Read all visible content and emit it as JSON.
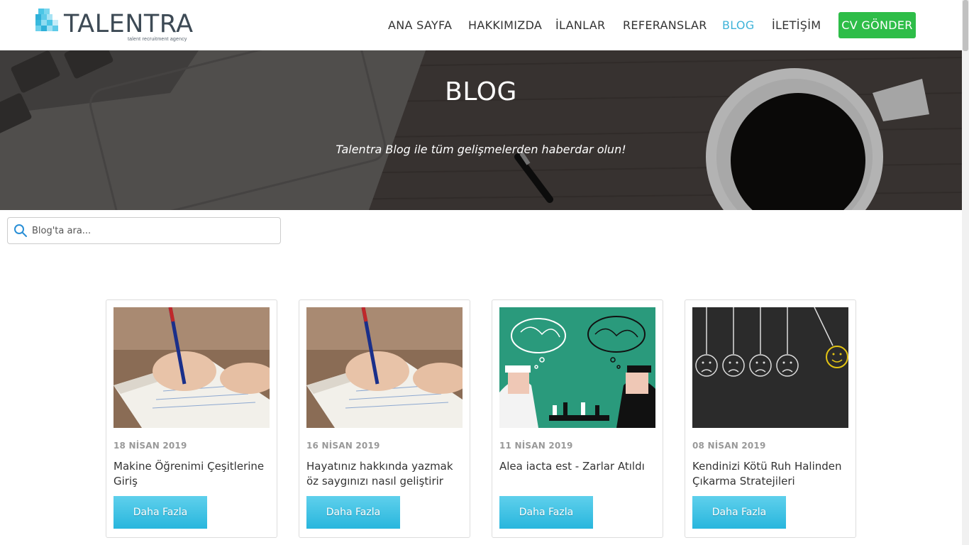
{
  "header": {
    "logo_text": "TALENTRA",
    "logo_tagline": "talent recruitment agency",
    "nav": [
      {
        "label": "ANA SAYFA"
      },
      {
        "label": "HAKKIMIZDA"
      },
      {
        "label": "İLANLAR"
      },
      {
        "label": "REFERANSLAR"
      },
      {
        "label": "BLOG",
        "active": true
      },
      {
        "label": "İLETİŞİM"
      }
    ],
    "cv_button": "CV GÖNDER"
  },
  "hero": {
    "title": "BLOG",
    "subtitle": "Talentra Blog ile tüm gelişmelerden haberdar olun!"
  },
  "search": {
    "placeholder": "Blog'ta ara..."
  },
  "posts": [
    {
      "date": "18 NİSAN 2019",
      "title": "Makine Öğrenimi Çeşitlerine Giriş",
      "button": "Daha Fazla",
      "image": "writing-notebook"
    },
    {
      "date": "16 NİSAN 2019",
      "title": "Hayatınız hakkında yazmak öz saygınızı nasıl geliştirir",
      "button": "Daha Fazla",
      "image": "writing-notebook"
    },
    {
      "date": "11 NİSAN 2019",
      "title": "Alea iacta est - Zarlar Atıldı",
      "button": "Daha Fazla",
      "image": "chess-players"
    },
    {
      "date": "08 NİSAN 2019",
      "title": "Kendinizi Kötü Ruh Halinden Çıkarma Stratejileri",
      "button": "Daha Fazla",
      "image": "faces-pendulum"
    }
  ],
  "colors": {
    "accent": "#3fb3d9",
    "cv_green": "#2ebd48",
    "button_blue": "#28b6dd"
  }
}
